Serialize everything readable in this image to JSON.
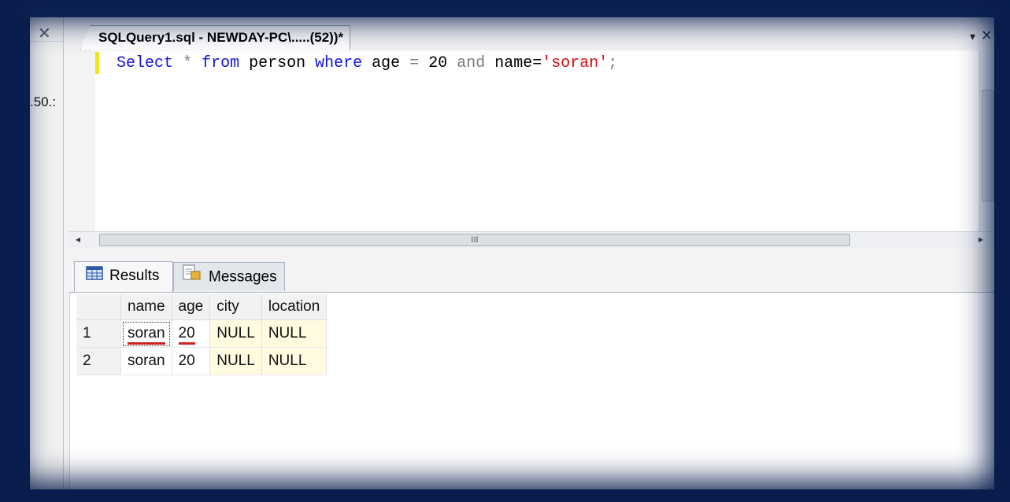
{
  "left_panel": {
    "close_glyph": "✕",
    "partial_text": ".50.:"
  },
  "document": {
    "tab_title": "SQLQuery1.sql - NEWDAY-PC\\.....(52))*",
    "dropdown_glyph": "▾",
    "close_glyph": "✕"
  },
  "editor": {
    "tokens": {
      "select": "Select",
      "star": "*",
      "from": "from",
      "table": "person",
      "where": "where",
      "col_age": "age",
      "eq1": "=",
      "num": "20",
      "and": "and",
      "col_name": "name=",
      "str": "'soran'",
      "semi": ";"
    }
  },
  "hscroll": {
    "left_arrow": "◂",
    "grip": "III",
    "right_arrow": "▸"
  },
  "results_tabs": [
    {
      "label": "Results",
      "icon": "grid-icon",
      "active": true
    },
    {
      "label": "Messages",
      "icon": "messages-icon",
      "active": false
    }
  ],
  "grid": {
    "columns": [
      "name",
      "age",
      "city",
      "location"
    ],
    "rows": [
      {
        "num": "1",
        "name": "soran",
        "age": "20",
        "city": "NULL",
        "location": "NULL"
      },
      {
        "num": "2",
        "name": "soran",
        "age": "20",
        "city": "NULL",
        "location": "NULL"
      }
    ]
  },
  "colors": {
    "keyword": "#1515d6",
    "string": "#d01010",
    "operator": "#7b7b7b",
    "frame": "#0b1f4f",
    "null_cell": "#fffbe0",
    "change_marker": "#f2e321"
  }
}
